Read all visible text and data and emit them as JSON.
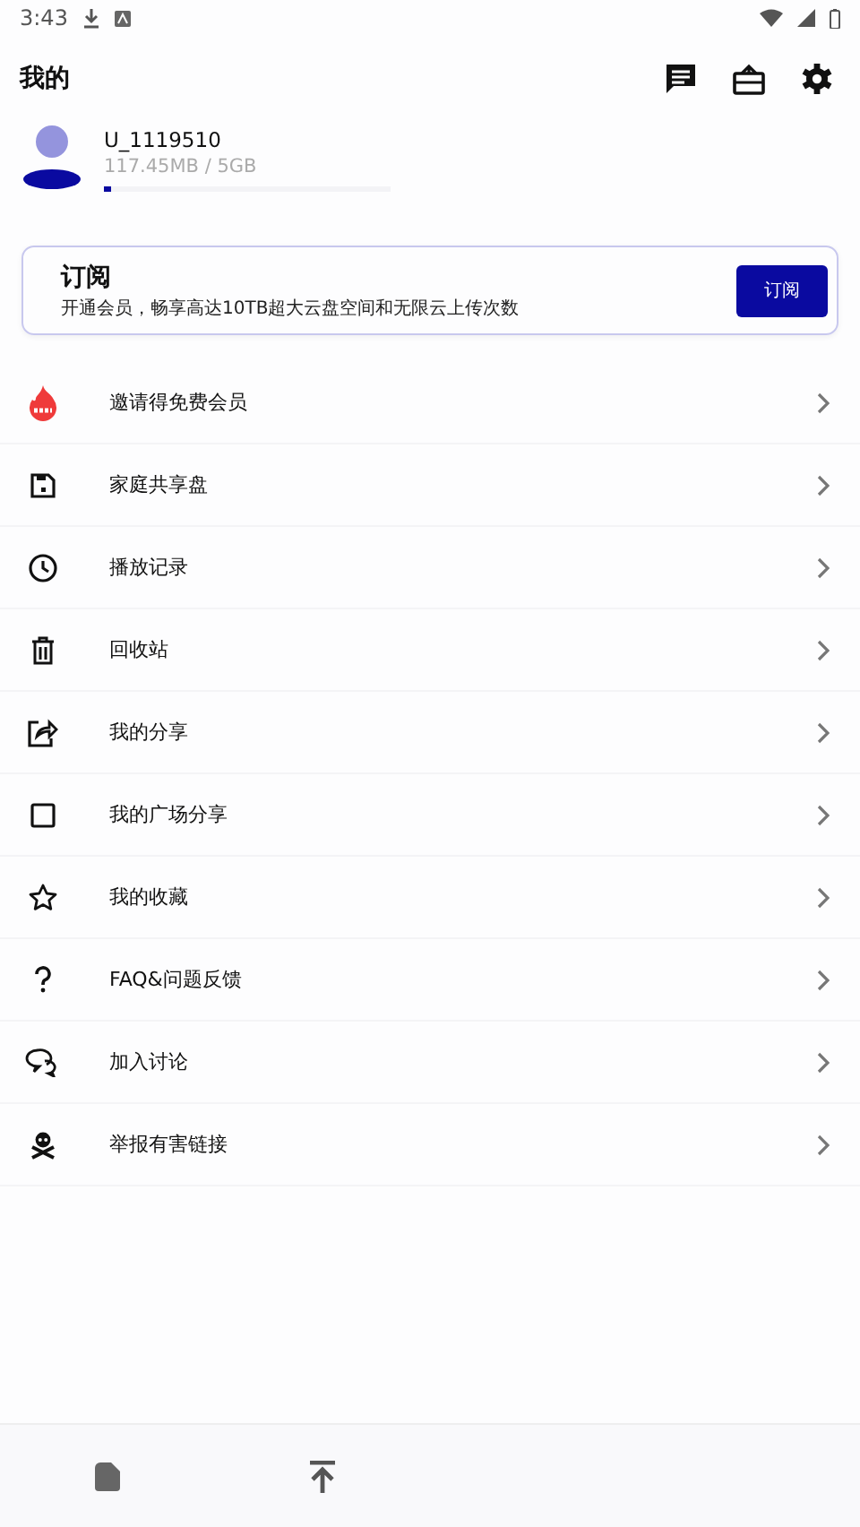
{
  "status_bar": {
    "time": "3:43"
  },
  "header": {
    "title": "我的"
  },
  "profile": {
    "username": "U_1119510",
    "storage": "117.45MB / 5GB",
    "level": 0.023
  },
  "subscription": {
    "title": "订阅",
    "description": "开通会员，畅享高达10TB超大云盘空间和无限云上传次数",
    "button": "订阅"
  },
  "menu": [
    {
      "kind": "hot",
      "label": "邀请得免费会员"
    },
    {
      "kind": "disk",
      "label": "家庭共享盘"
    },
    {
      "kind": "clock",
      "label": "播放记录"
    },
    {
      "kind": "trash",
      "label": "回收站"
    },
    {
      "kind": "share",
      "label": "我的分享"
    },
    {
      "kind": "square",
      "label": "我的广场分享"
    },
    {
      "kind": "star",
      "label": "我的收藏"
    },
    {
      "kind": "question",
      "label": "FAQ&问题反馈"
    },
    {
      "kind": "chat",
      "label": "加入讨论"
    },
    {
      "kind": "skull",
      "label": "举报有害链接"
    }
  ],
  "bottom_nav": [
    {
      "kind": "file"
    },
    {
      "kind": "upload"
    }
  ]
}
